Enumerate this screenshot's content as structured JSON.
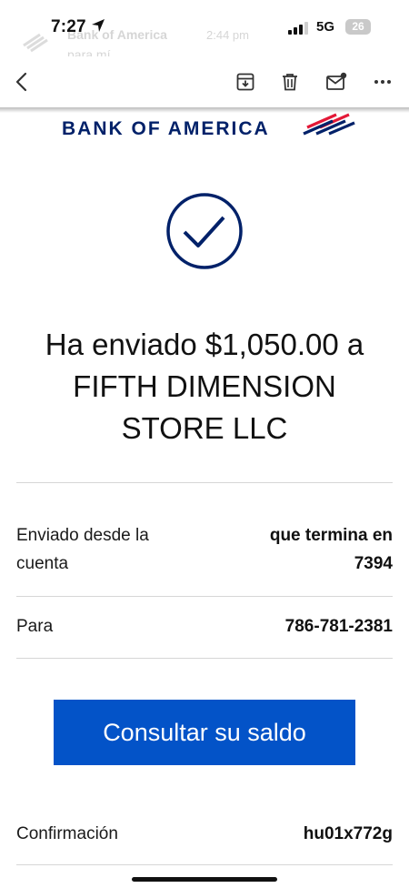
{
  "status_bar": {
    "time": "7:27",
    "network": "5G",
    "battery": "26",
    "notification_title": "Bank of America",
    "notification_time": "2:44 pm",
    "notification_sub": "para mí"
  },
  "icons": {
    "back": "chevron-left-icon",
    "archive": "archive-icon",
    "delete": "trash-icon",
    "mark_unread": "mail-unread-icon",
    "more": "more-icon",
    "confirm": "checkmark-circle-icon"
  },
  "colors": {
    "brand_blue": "#012169",
    "brand_red": "#e31837",
    "button_blue": "#0353c8"
  },
  "email": {
    "brand": "BANK OF AMERICA",
    "headline_line1": "Ha enviado $1,050.00 a",
    "headline_line2": "FIFTH DIMENSION",
    "headline_line3": "STORE LLC",
    "rows": [
      {
        "label_line1": "Enviado desde la",
        "label_line2": "cuenta",
        "value_line1": "que termina en",
        "value_line2": "7394"
      },
      {
        "label": "Para",
        "value": "786-781-2381"
      },
      {
        "label": "Confirmación",
        "value": "hu01x772g"
      }
    ],
    "cta": "Consultar su saldo"
  }
}
